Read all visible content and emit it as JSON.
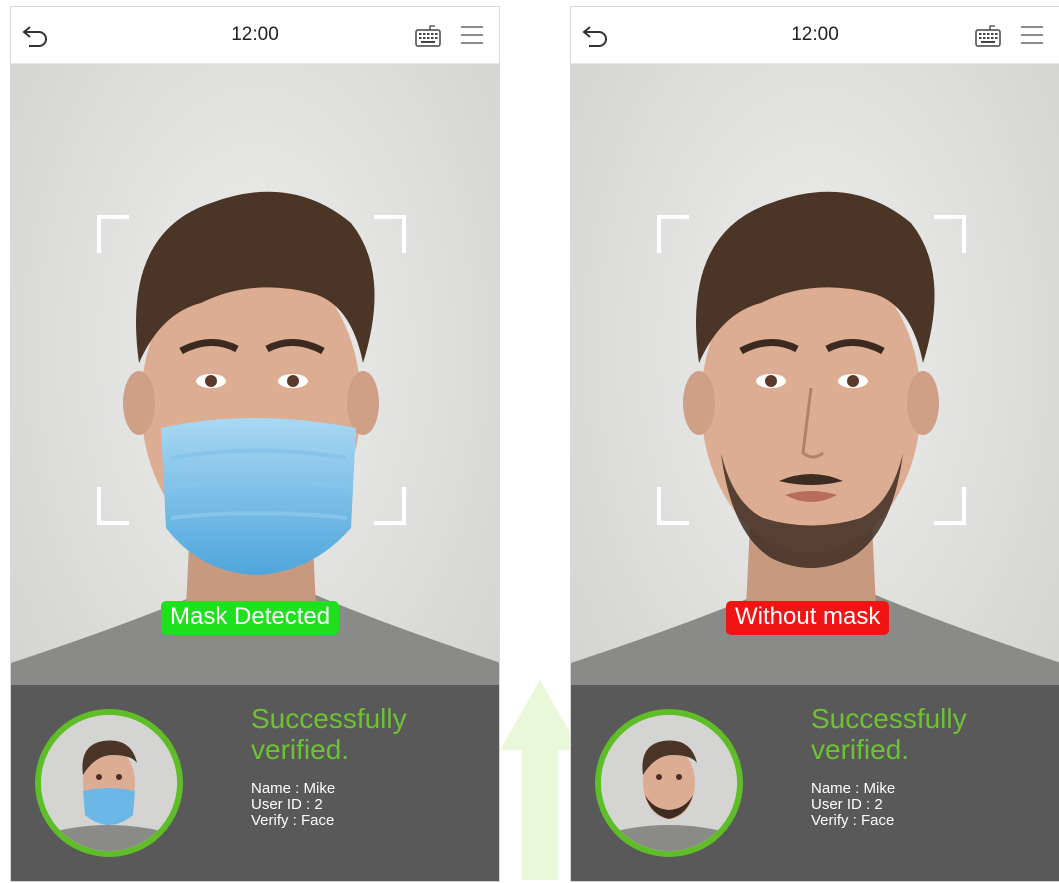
{
  "colors": {
    "accent_green": "#5fbd27",
    "success_text": "#6cc233",
    "mask_detected": "#1ee01e",
    "without_mask": "#f01414",
    "panel": "#525252"
  },
  "icons": [
    "back-arrow-icon",
    "keyboard-icon",
    "menu-icon",
    "green-arrow-icon"
  ],
  "screens": [
    {
      "time": "12:00",
      "detection_label": "Mask Detected",
      "status_line1": "Successfully",
      "status_line2": "verified.",
      "name_line": "Name : Mike",
      "user_id_line": "User ID : 2",
      "verify_line": "Verify : Face",
      "masked": true
    },
    {
      "time": "12:00",
      "detection_label": "Without mask",
      "status_line1": "Successfully",
      "status_line2": "verified.",
      "name_line": "Name : Mike",
      "user_id_line": "User ID : 2",
      "verify_line": "Verify : Face",
      "masked": false
    }
  ]
}
